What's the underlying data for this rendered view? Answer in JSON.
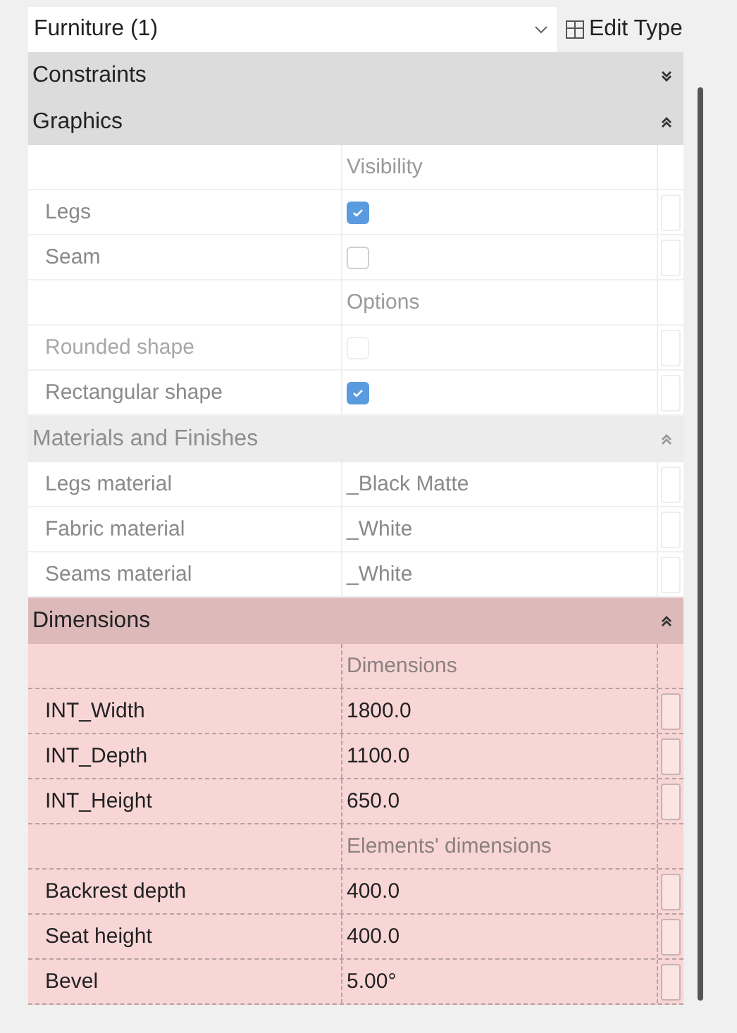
{
  "type_selector": {
    "value": "Furniture (1)"
  },
  "edit_type_button": {
    "label": "Edit Type"
  },
  "sections": [
    {
      "title": "Constraints",
      "expanded": false,
      "faded": false,
      "highlighted": false
    },
    {
      "title": "Graphics",
      "expanded": true,
      "faded": false,
      "highlighted": false,
      "rows": [
        {
          "kind": "subheader",
          "value": "Visibility",
          "faded": true,
          "disabled": false
        },
        {
          "kind": "checkbox",
          "label": "Legs",
          "checked": true,
          "faded": true,
          "disabled": false
        },
        {
          "kind": "checkbox",
          "label": "Seam",
          "checked": false,
          "faded": true,
          "disabled": false
        },
        {
          "kind": "subheader",
          "value": "Options",
          "faded": true,
          "disabled": false
        },
        {
          "kind": "checkbox",
          "label": "Rounded shape",
          "checked": false,
          "faded": true,
          "disabled": true
        },
        {
          "kind": "checkbox",
          "label": "Rectangular shape",
          "checked": true,
          "faded": true,
          "disabled": false
        }
      ]
    },
    {
      "title": "Materials and Finishes",
      "expanded": true,
      "faded": true,
      "highlighted": false,
      "rows": [
        {
          "kind": "text",
          "label": "Legs material",
          "value": "_Black Matte",
          "faded": true,
          "disabled": false
        },
        {
          "kind": "text",
          "label": "Fabric material",
          "value": "_White",
          "faded": true,
          "disabled": false
        },
        {
          "kind": "text",
          "label": "Seams material",
          "value": "_White",
          "faded": true,
          "disabled": false
        }
      ]
    },
    {
      "title": "Dimensions",
      "expanded": true,
      "faded": false,
      "highlighted": true,
      "rows": [
        {
          "kind": "subheader",
          "value": "Dimensions",
          "faded": false,
          "disabled": false
        },
        {
          "kind": "text",
          "label": "INT_Width",
          "value": "1800.0",
          "faded": false,
          "disabled": false
        },
        {
          "kind": "text",
          "label": "INT_Depth",
          "value": "1100.0",
          "faded": false,
          "disabled": false
        },
        {
          "kind": "text",
          "label": "INT_Height",
          "value": "650.0",
          "faded": false,
          "disabled": false
        },
        {
          "kind": "subheader",
          "value": "Elements' dimensions",
          "faded": false,
          "disabled": false
        },
        {
          "kind": "text",
          "label": "Backrest depth",
          "value": "400.0",
          "faded": false,
          "disabled": false
        },
        {
          "kind": "text",
          "label": "Seat height",
          "value": "400.0",
          "faded": false,
          "disabled": false
        },
        {
          "kind": "text",
          "label": "Bevel",
          "value": "5.00°",
          "faded": false,
          "disabled": false
        }
      ]
    }
  ]
}
